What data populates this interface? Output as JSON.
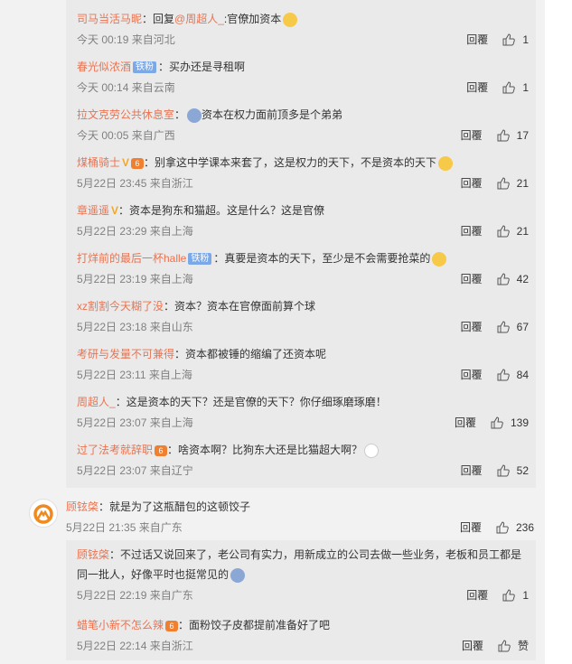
{
  "replies": [
    {
      "name": "司马当活马昵",
      "segments": [
        {
          "t": "：回复",
          "m": false
        },
        {
          "t": "@周超人_",
          "m": true
        },
        {
          "t": ":官僚加资本",
          "m": false
        }
      ],
      "emoji": "yellow",
      "meta": "今天 00:19 来自河北",
      "reply": "回覆",
      "likes": "1"
    },
    {
      "name": "春光似浓酒",
      "badge": "铁粉",
      "segments": [
        {
          "t": "：买办还是寻租啊",
          "m": false
        }
      ],
      "meta": "今天 00:14 来自云南",
      "reply": "回覆",
      "likes": "1"
    },
    {
      "name": "拉文克劳公共休息室",
      "segments": [
        {
          "t": "：",
          "m": false
        }
      ],
      "pre_emoji": "blue",
      "segments2": "资本在权力面前顶多是个弟弟",
      "meta": "今天 00:05 来自广西",
      "reply": "回覆",
      "likes": "17"
    },
    {
      "name": "煤桶骑士",
      "vip": "V",
      "lvl": "6",
      "segments": [
        {
          "t": "：别拿这中学课本来套了，这是权力的天下，不是资本的天下",
          "m": false
        }
      ],
      "emoji": "yellow",
      "meta": "5月22日 23:45 来自浙江",
      "reply": "回覆",
      "likes": "21"
    },
    {
      "name": "章遥遥",
      "vip": "V",
      "segments": [
        {
          "t": "：资本是狗东和猫超。这是什么？这是官僚",
          "m": false
        }
      ],
      "meta": "5月22日 23:29 来自上海",
      "reply": "回覆",
      "likes": "21"
    },
    {
      "name": "打烊前的最后一杯halle",
      "badge": "铁粉",
      "segments": [
        {
          "t": "：真要是资本的天下，至少是不会需要抢菜的",
          "m": false
        }
      ],
      "emoji": "yellow",
      "meta": "5月22日 23:19 来自上海",
      "reply": "回覆",
      "likes": "42"
    },
    {
      "name": "xz割割今天糊了没",
      "segments": [
        {
          "t": "：资本？资本在官僚面前算个球",
          "m": false
        }
      ],
      "meta": "5月22日 23:18 来自山东",
      "reply": "回覆",
      "likes": "67"
    },
    {
      "name": "考研与发量不可兼得",
      "segments": [
        {
          "t": "：资本都被锤的缩编了还资本呢",
          "m": false
        }
      ],
      "meta": "5月22日 23:11 来自上海",
      "reply": "回覆",
      "likes": "84"
    },
    {
      "name": "周超人_",
      "segments": [
        {
          "t": "：这是资本的天下？还是官僚的天下？你仔细琢磨琢磨！",
          "m": false
        }
      ],
      "meta": "5月22日 23:07 来自上海",
      "reply": "回覆",
      "likes": "139"
    },
    {
      "name": "过了法考就辞职",
      "lvl": "6",
      "segments": [
        {
          "t": "：啥资本啊？比狗东大还是比猫超大啊？",
          "m": false
        }
      ],
      "emoji": "white",
      "meta": "5月22日 23:07 来自辽宁",
      "reply": "回覆",
      "likes": "52"
    }
  ],
  "top_comment": {
    "name": "顾铉棨",
    "text": "：就是为了这瓶醋包的这顿饺子",
    "meta": "5月22日 21:35 来自广东",
    "reply": "回覆",
    "likes": "236"
  },
  "sub_replies": [
    {
      "name": "顾铉棨",
      "text1": "：不过话又说回来了，老公司有实力，用新成立的公司去做一些业务，老板和员工都是",
      "text2": "同一批人，好像平时也挺常见的",
      "meta": "5月22日 22:19 来自广东",
      "reply": "回覆",
      "likes": "1"
    },
    {
      "name": "蜡笔小新不怎么辣",
      "lvl": "6",
      "text1": "：面粉饺子皮都提前准备好了吧",
      "meta": "5月22日 22:14 来自浙江",
      "reply": "回覆",
      "likes": "赞"
    }
  ]
}
